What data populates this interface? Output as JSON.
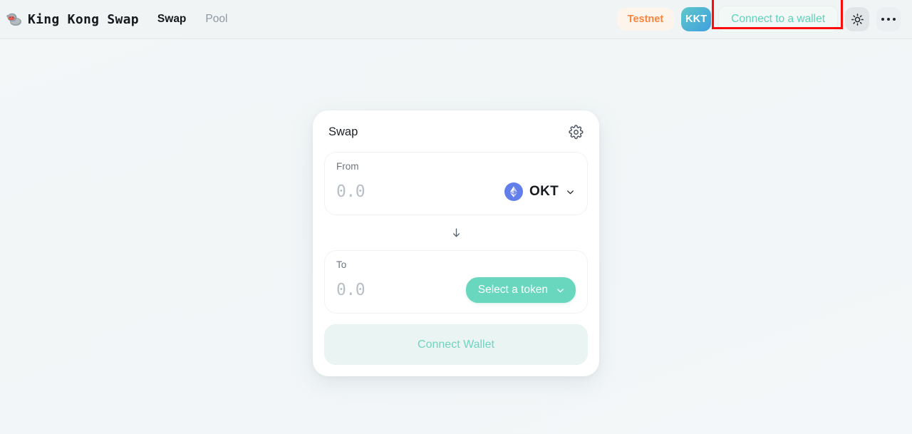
{
  "header": {
    "brand": {
      "name": "King Kong Swap",
      "logo_icon": "gorilla-icon"
    },
    "nav": [
      {
        "label": "Swap",
        "active": true
      },
      {
        "label": "Pool",
        "active": false
      }
    ],
    "network_badge": "Testnet",
    "token_badge": "KKT",
    "connect_wallet_label": "Connect to a wallet",
    "theme_toggle_icon": "sun-icon",
    "more_menu_icon": "ellipsis-icon",
    "annotation": {
      "target": "connect-to-a-wallet-button",
      "color": "#fb0d0d"
    }
  },
  "swap_card": {
    "title": "Swap",
    "settings_icon": "gear-icon",
    "from": {
      "label": "From",
      "amount_value": "",
      "amount_placeholder": "0.0",
      "token_symbol": "OKT",
      "token_icon": "okt-token-icon",
      "chevron_icon": "chevron-down-icon"
    },
    "swap_direction_icon": "arrow-down-icon",
    "to": {
      "label": "To",
      "amount_value": "",
      "amount_placeholder": "0.0",
      "select_token_label": "Select a token",
      "chevron_icon": "chevron-down-icon"
    },
    "action_button_label": "Connect Wallet"
  },
  "colors": {
    "accent_teal": "#68d7bd",
    "accent_orange": "#f5853f",
    "annotation_red": "#fb0d0d",
    "token_blue": "#627eea",
    "page_background": "#f3f7f8"
  }
}
